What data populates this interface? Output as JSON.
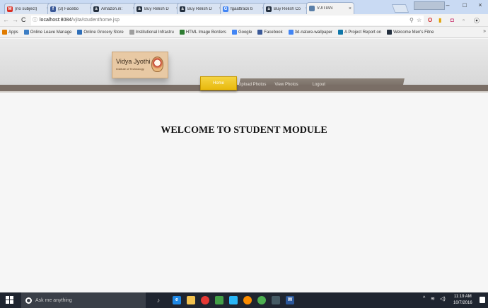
{
  "browser": {
    "tabs": [
      {
        "title": "(no subject)",
        "icon": "gmail-icon",
        "color": "#d93025",
        "glyph": "M"
      },
      {
        "title": "(3) Facebo",
        "icon": "facebook-icon",
        "color": "#3b5998",
        "glyph": "f"
      },
      {
        "title": "Amazon.in: ",
        "icon": "amazon-icon",
        "color": "#232f3e",
        "glyph": "a"
      },
      {
        "title": "Buy Relish D",
        "icon": "amazon-icon",
        "color": "#232f3e",
        "glyph": "a"
      },
      {
        "title": "Buy Relish D",
        "icon": "amazon-icon",
        "color": "#232f3e",
        "glyph": "a"
      },
      {
        "title": "fgaattrack b",
        "icon": "google-icon",
        "color": "#4285f4",
        "glyph": "G"
      },
      {
        "title": "Buy Relish Co",
        "icon": "amazon-icon",
        "color": "#232f3e",
        "glyph": "a"
      },
      {
        "title": "VJITIAN",
        "icon": "page-icon",
        "color": "#5a7fa8",
        "glyph": ""
      }
    ],
    "window_controls": {
      "minimize": "–",
      "maximize": "□",
      "close": "×"
    },
    "address": {
      "host": "localhost:8084",
      "path": "/vjita/studenthome.jsp"
    },
    "bookmarks": [
      {
        "label": "Apps",
        "icon": "apps-icon",
        "color": "#e07b00"
      },
      {
        "label": "Online Leave Manage",
        "icon": "leave-icon",
        "color": "#3c7dc4"
      },
      {
        "label": "Online Grocery Store",
        "icon": "grocery-icon",
        "color": "#2f6fb8"
      },
      {
        "label": "Institutional Infrastru",
        "icon": "page-icon",
        "color": "#9e9e9e"
      },
      {
        "label": "HTML Image Borders",
        "icon": "html-icon",
        "color": "#2e7d32"
      },
      {
        "label": "Google",
        "icon": "google-icon",
        "color": "#4285f4"
      },
      {
        "label": "Facebook",
        "icon": "facebook-icon",
        "color": "#3b5998"
      },
      {
        "label": "3d-nature-wallpaper",
        "icon": "google-icon",
        "color": "#4285f4"
      },
      {
        "label": "A Project Report on",
        "icon": "linkedin-icon",
        "color": "#0e76a8"
      },
      {
        "label": "Welcome Men's Fitne",
        "icon": "amazon-icon",
        "color": "#232f3e"
      }
    ]
  },
  "site": {
    "logo": {
      "name": "Vidya Jyothi",
      "sub": "Institute of Technology"
    },
    "menu": [
      "Home",
      "Upload Photos",
      "View Photos",
      "Logout"
    ],
    "headline": "WELCOME TO STUDENT MODULE"
  },
  "taskbar": {
    "search_placeholder": "Ask me anything",
    "time": "11:19 AM",
    "date": "10/7/2016"
  }
}
